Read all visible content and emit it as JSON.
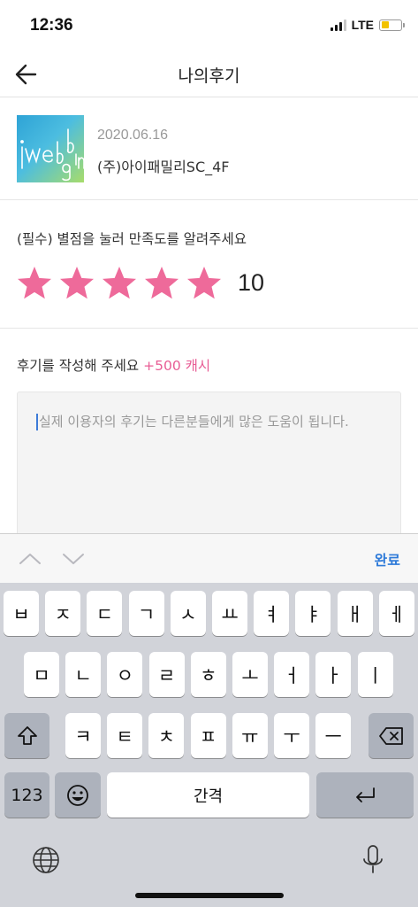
{
  "status_bar": {
    "time": "12:36",
    "network": "LTE",
    "battery_level": 0.4
  },
  "nav": {
    "title": "나의후기",
    "back_icon": "arrow-left-icon"
  },
  "product": {
    "thumbnail_text": "iwedding",
    "date": "2020.06.16",
    "name": "(주)아이패밀리SC_4F"
  },
  "rating": {
    "label": "(필수) 별점을 눌러 만족도를 알려주세요",
    "stars_filled": 5,
    "stars_total": 5,
    "score": "10",
    "star_color": "#ee6a9a"
  },
  "review": {
    "label": "후기를 작성해 주세요",
    "bonus": "+500 캐시",
    "placeholder": "실제 이용자의 후기는 다른분들에게 많은 도움이 됩니다.",
    "bonus_color": "#e85d95"
  },
  "accessory": {
    "prev_icon": "chevron-up-icon",
    "next_icon": "chevron-down-icon",
    "done_label": "완료"
  },
  "keyboard": {
    "row1": [
      "ㅂ",
      "ㅈ",
      "ㄷ",
      "ㄱ",
      "ㅅ",
      "ㅛ",
      "ㅕ",
      "ㅑ",
      "ㅐ",
      "ㅔ"
    ],
    "row2": [
      "ㅁ",
      "ㄴ",
      "ㅇ",
      "ㄹ",
      "ㅎ",
      "ㅗ",
      "ㅓ",
      "ㅏ",
      "ㅣ"
    ],
    "row3": [
      "ㅋ",
      "ㅌ",
      "ㅊ",
      "ㅍ",
      "ㅠ",
      "ㅜ",
      "ㅡ"
    ],
    "numbers_label": "123",
    "space_label": "간격",
    "shift_icon": "shift-icon",
    "delete_icon": "backspace-icon",
    "emoji_icon": "emoji-icon",
    "return_icon": "return-icon",
    "globe_icon": "globe-icon",
    "mic_icon": "microphone-icon"
  }
}
